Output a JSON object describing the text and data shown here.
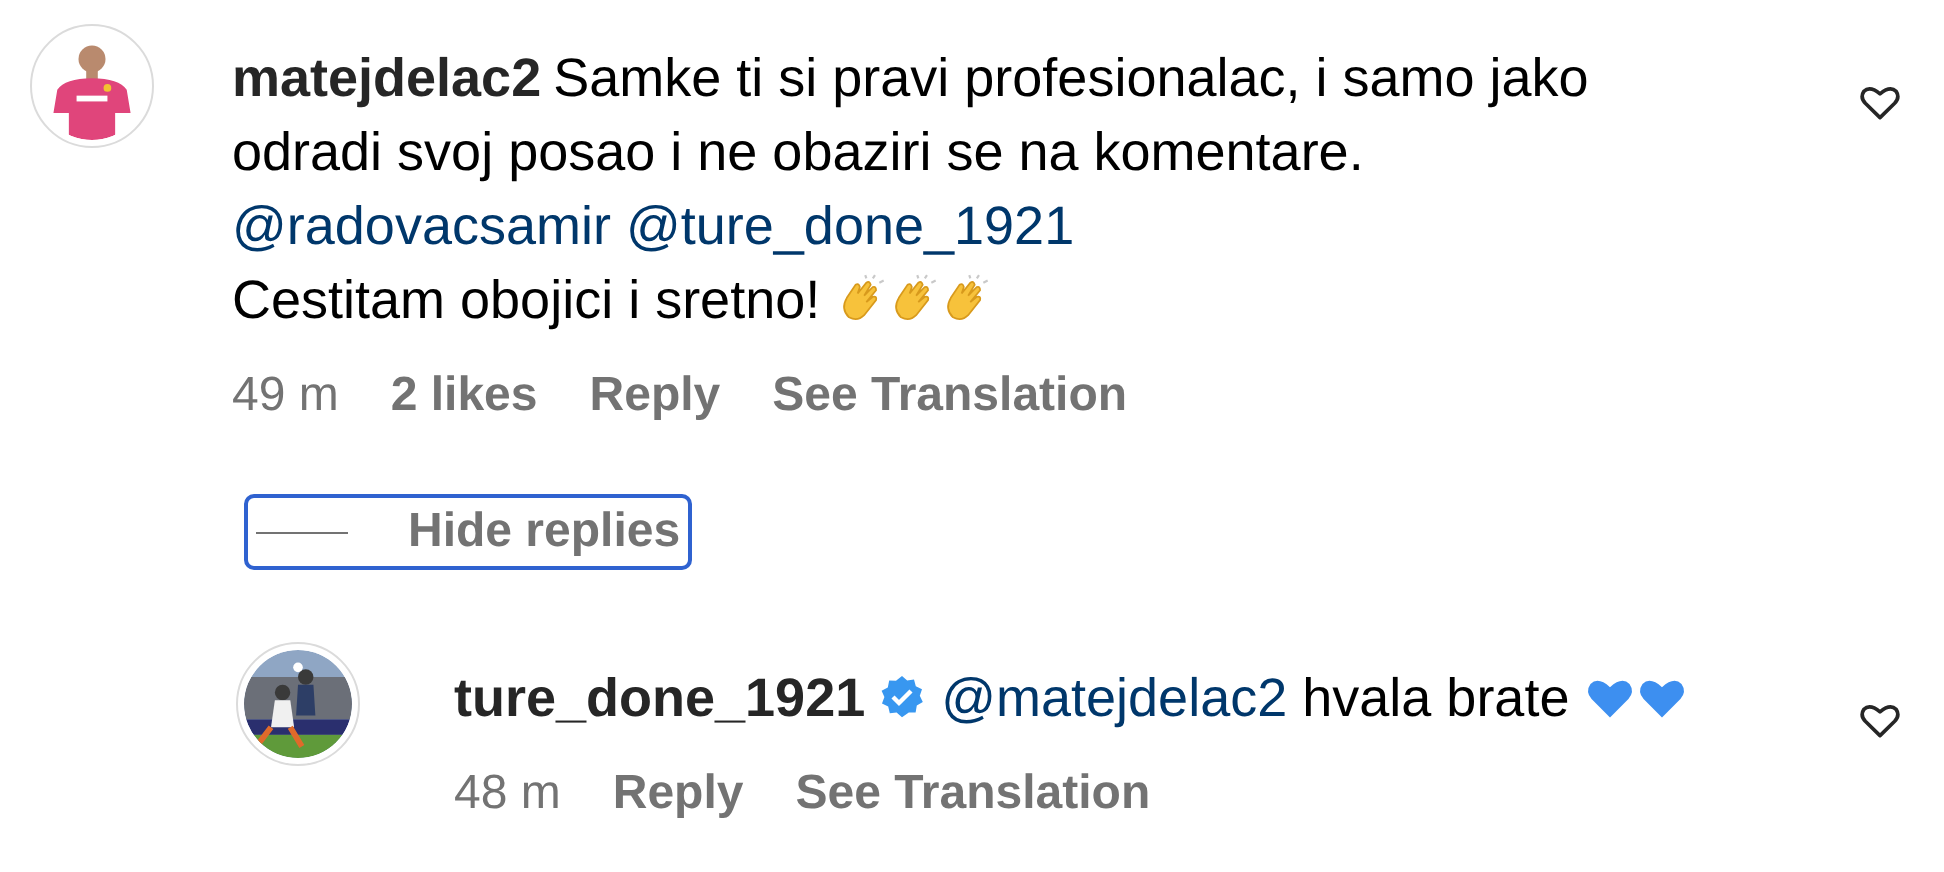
{
  "comments": [
    {
      "username": "matejdelac2",
      "verified": false,
      "avatar": {
        "kind": "picture"
      },
      "parts": [
        {
          "kind": "text",
          "text": "Samke ti si pravi profesionalac, i samo jako odradi svoj posao i ne obaziri se na komentare."
        },
        {
          "kind": "mention",
          "text": "@radovacsamir"
        },
        {
          "kind": "mention",
          "text": "@ture_done_1921"
        },
        {
          "kind": "break"
        },
        {
          "kind": "text",
          "text": "Cestitam obojici i sretno!"
        },
        {
          "kind": "clap"
        },
        {
          "kind": "clap"
        },
        {
          "kind": "clap"
        }
      ],
      "meta": [
        {
          "kind": "time",
          "text": "49 m"
        },
        {
          "kind": "action",
          "text": "2 likes"
        },
        {
          "kind": "action",
          "text": "Reply"
        },
        {
          "kind": "action",
          "text": "See Translation"
        }
      ],
      "toggle": {
        "label": "Hide replies"
      },
      "replies": [
        {
          "username": "ture_done_1921",
          "verified": true,
          "avatar": {
            "kind": "picture"
          },
          "parts": [
            {
              "kind": "mention",
              "text": "@matejdelac2"
            },
            {
              "kind": "text",
              "text": "hvala brate"
            },
            {
              "kind": "blue_heart"
            },
            {
              "kind": "blue_heart"
            }
          ],
          "meta": [
            {
              "kind": "time",
              "text": "48 m"
            },
            {
              "kind": "action",
              "text": "Reply"
            },
            {
              "kind": "action",
              "text": "See Translation"
            }
          ]
        }
      ]
    }
  ]
}
